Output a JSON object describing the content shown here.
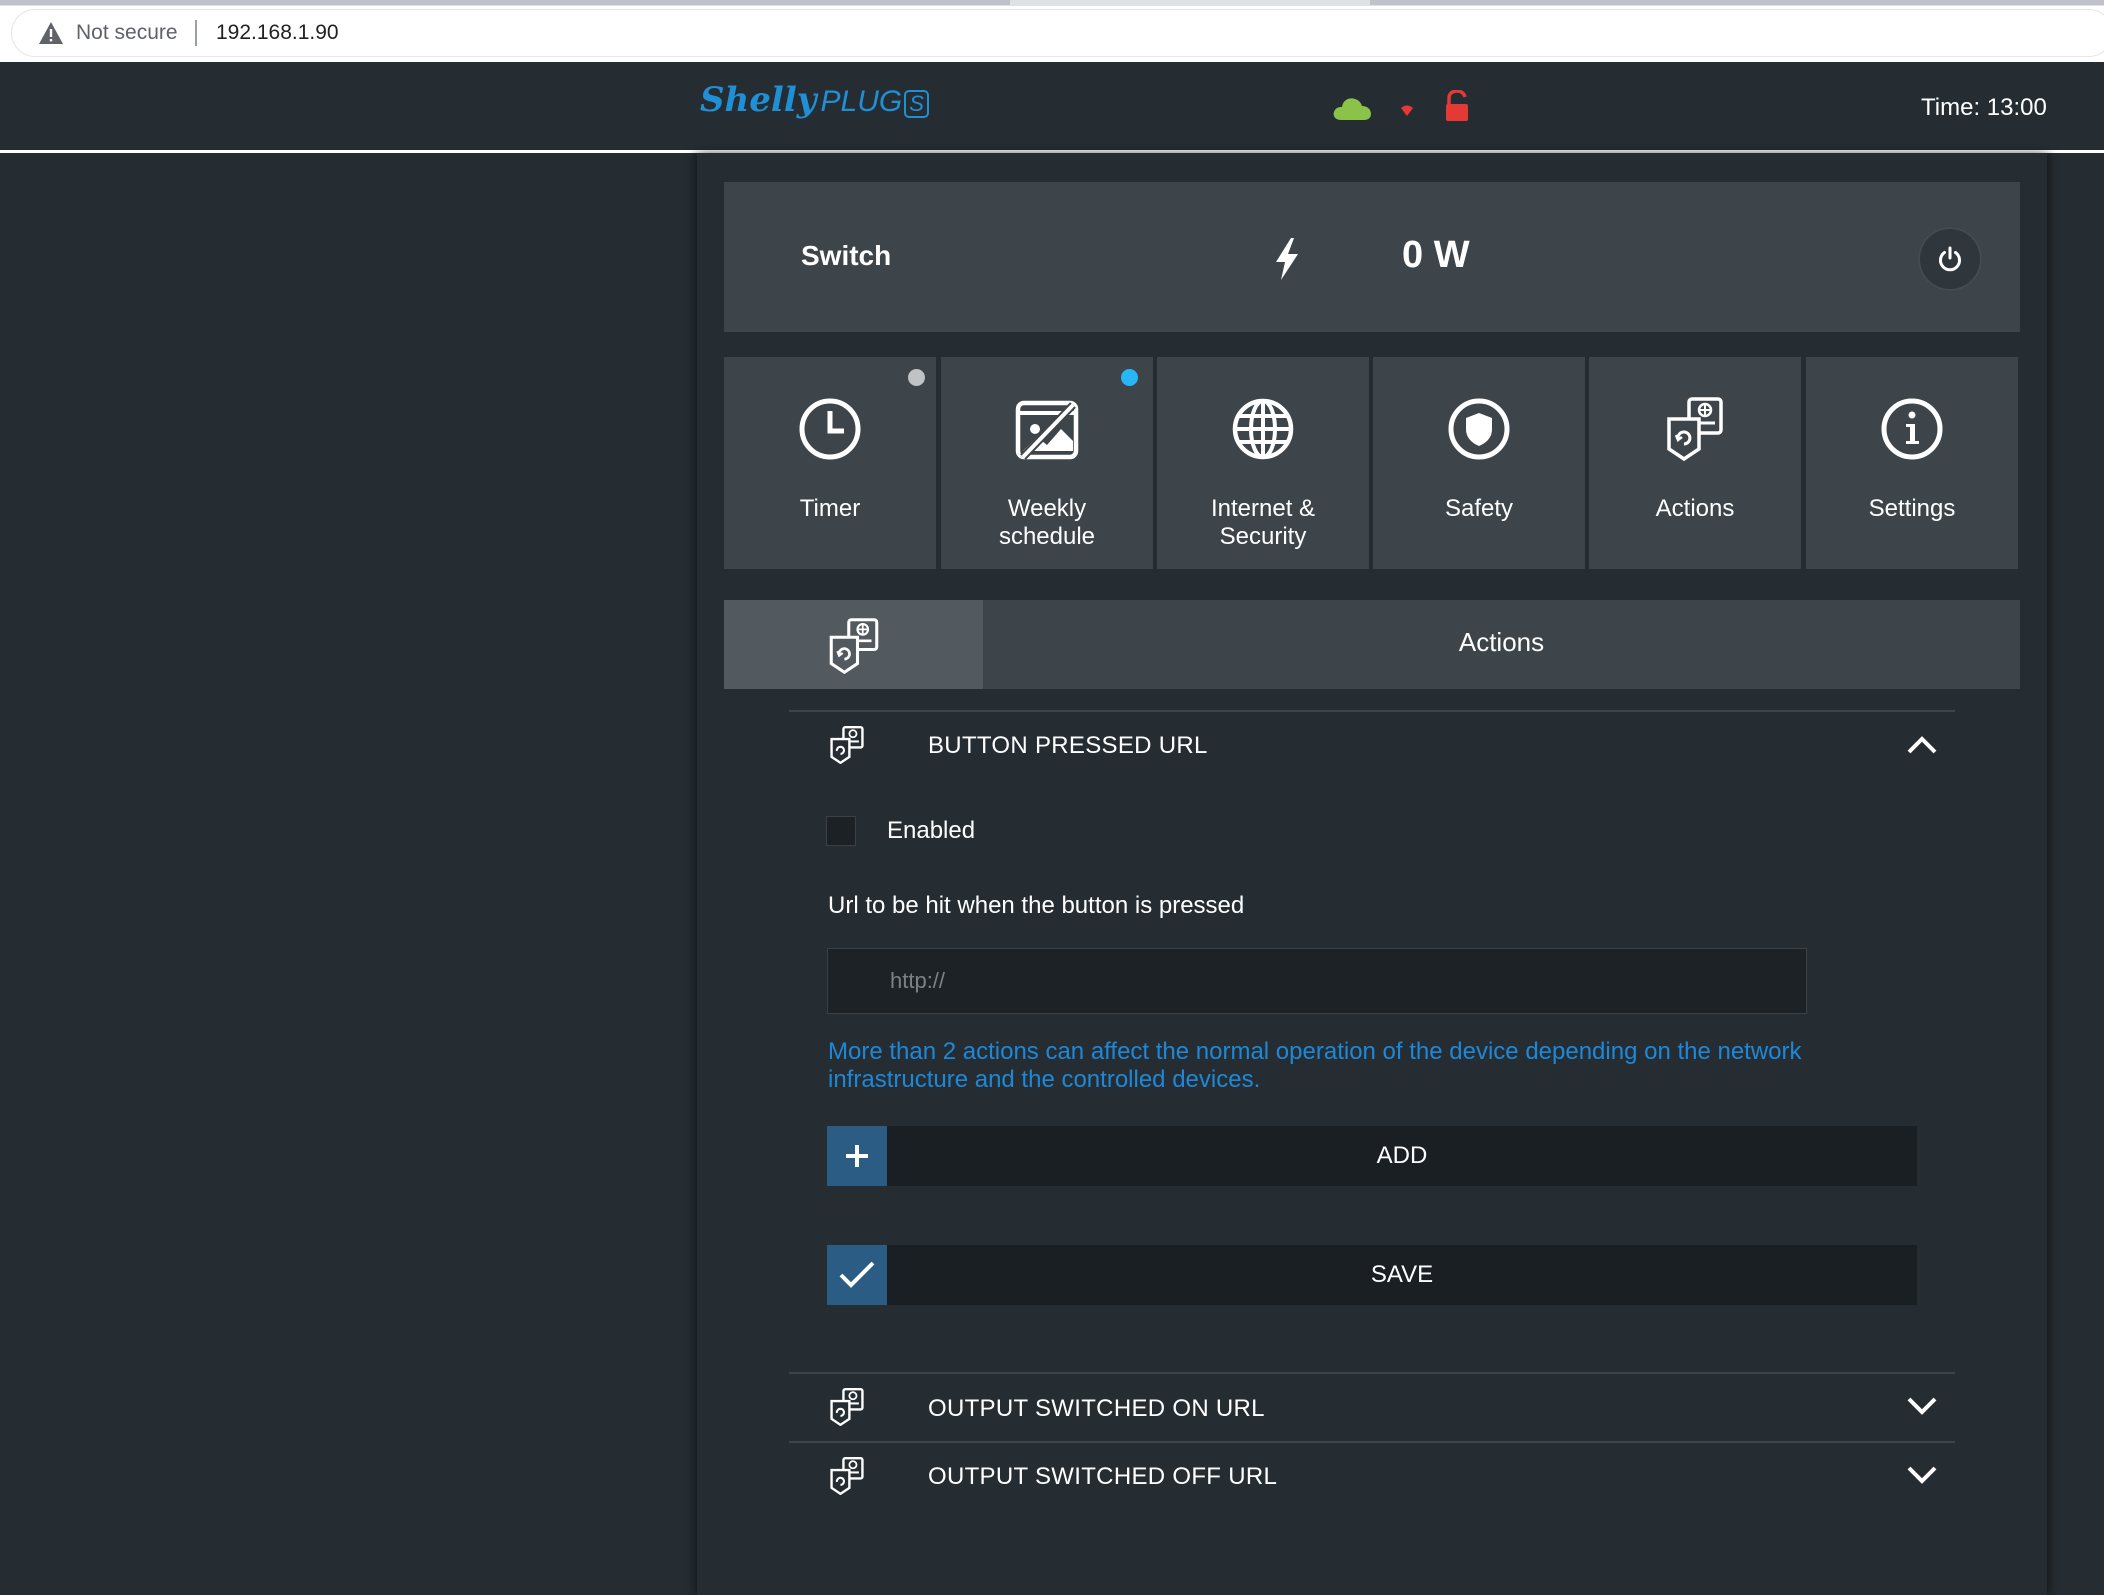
{
  "browser": {
    "security_label": "Not secure",
    "url": "192.168.1.90"
  },
  "header": {
    "logo_text": "Shelly",
    "product_text": "PLUG",
    "product_suffix": "S",
    "time_label": "Time: 13:00"
  },
  "switch": {
    "label": "Switch",
    "power": "0 W"
  },
  "tiles": [
    {
      "label": "Timer",
      "icon": "clock-icon",
      "indicator": "#c0c3c6"
    },
    {
      "label": "Weekly\nschedule",
      "icon": "calendar-icon",
      "indicator": "#29b6f6"
    },
    {
      "label": "Internet &\nSecurity",
      "icon": "globe-icon"
    },
    {
      "label": "Safety",
      "icon": "shield-icon"
    },
    {
      "label": "Actions",
      "icon": "actions-icon"
    },
    {
      "label": "Settings",
      "icon": "info-icon"
    }
  ],
  "actions_panel": {
    "title": "Actions",
    "sections": [
      {
        "title": "BUTTON PRESSED URL",
        "expanded": true
      },
      {
        "title": "OUTPUT SWITCHED ON URL",
        "expanded": false
      },
      {
        "title": "OUTPUT SWITCHED OFF URL",
        "expanded": false
      }
    ],
    "enabled_label": "Enabled",
    "url_description": "Url to be hit when the button is pressed",
    "url_placeholder": "http://",
    "warning": "More than 2 actions can affect the normal operation of the device depending on the network infrastructure and the controlled devices.",
    "add_label": "ADD",
    "save_label": "SAVE"
  },
  "colors": {
    "background": "#262d32",
    "tile": "#3d454b",
    "accent_blue": "#2a5c84",
    "warning_text": "#1e88d8",
    "cloud": "#8bc34a",
    "lock": "#e53935"
  }
}
